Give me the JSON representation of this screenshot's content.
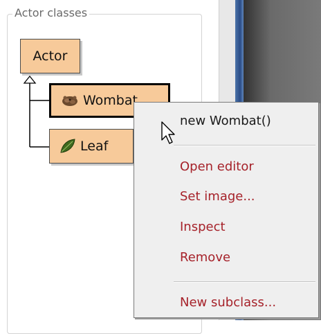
{
  "panel": {
    "title": "Actor classes"
  },
  "classes": {
    "actor": {
      "label": "Actor"
    },
    "wombat": {
      "label": "Wombat",
      "icon": "wombat-icon"
    },
    "leaf": {
      "label": "Leaf",
      "icon": "leaf-icon"
    }
  },
  "context_menu": {
    "items": [
      {
        "label": "new Wombat()"
      },
      {
        "label": "Open editor"
      },
      {
        "label": "Set image..."
      },
      {
        "label": "Inspect"
      },
      {
        "label": "Remove"
      },
      {
        "label": "New subclass..."
      }
    ]
  },
  "colors": {
    "class_fill": "#f7ca9a",
    "menu_text": "#a6222a",
    "menu_bg": "#efefef"
  }
}
